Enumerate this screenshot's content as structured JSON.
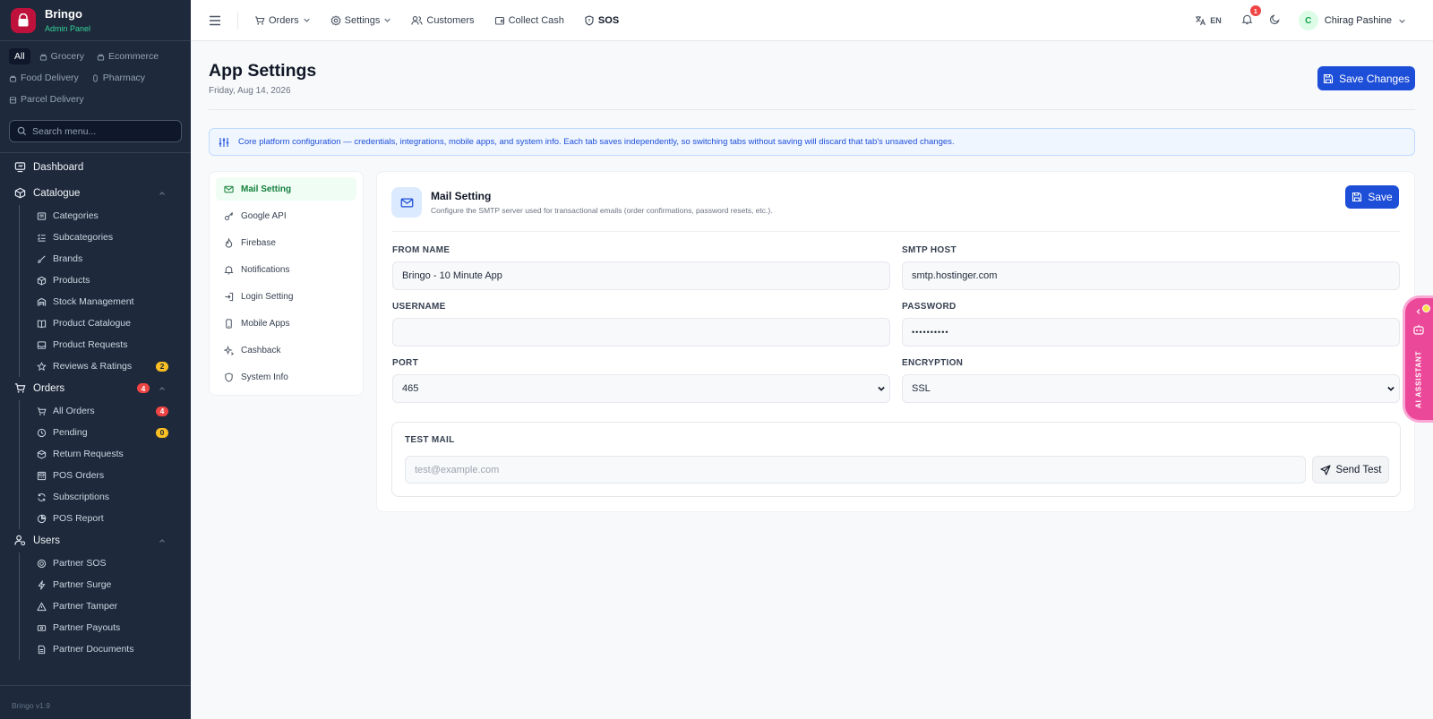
{
  "brand": {
    "name": "Bringo",
    "subtitle": "Admin Panel",
    "version": "Bringo v1.9"
  },
  "sidebar": {
    "filters": [
      "All",
      "Grocery",
      "Ecommerce",
      "Food Delivery",
      "Pharmacy",
      "Parcel Delivery"
    ],
    "search_placeholder": "Search menu...",
    "dashboard": "Dashboard",
    "catalogue": {
      "label": "Catalogue",
      "items": [
        {
          "label": "Categories",
          "icon": "folder-icon"
        },
        {
          "label": "Subcategories",
          "icon": "list-check-icon"
        },
        {
          "label": "Brands",
          "icon": "brush-icon"
        },
        {
          "label": "Products",
          "icon": "box-icon"
        },
        {
          "label": "Stock Management",
          "icon": "warehouse-icon"
        },
        {
          "label": "Product Catalogue",
          "icon": "book-icon"
        },
        {
          "label": "Product Requests",
          "icon": "inbox-icon"
        },
        {
          "label": "Reviews & Ratings",
          "icon": "star-icon",
          "badge": "2"
        }
      ]
    },
    "orders": {
      "label": "Orders",
      "badge": "4",
      "items": [
        {
          "label": "All Orders",
          "icon": "cart-icon",
          "badge": "4"
        },
        {
          "label": "Pending",
          "icon": "clock-icon",
          "badge": "0"
        },
        {
          "label": "Return Requests",
          "icon": "return-box-icon"
        },
        {
          "label": "POS Orders",
          "icon": "pos-icon"
        },
        {
          "label": "Subscriptions",
          "icon": "refresh-icon"
        },
        {
          "label": "POS Report",
          "icon": "pie-chart-icon"
        }
      ]
    },
    "users": {
      "label": "Users",
      "items": [
        {
          "label": "Partner SOS",
          "icon": "sos-icon"
        },
        {
          "label": "Partner Surge",
          "icon": "bolt-icon"
        },
        {
          "label": "Partner Tamper",
          "icon": "warning-icon"
        },
        {
          "label": "Partner Payouts",
          "icon": "payout-icon"
        },
        {
          "label": "Partner Documents",
          "icon": "document-icon"
        }
      ]
    }
  },
  "topbar": {
    "nav": [
      {
        "label": "Orders",
        "icon": "cart-icon",
        "dropdown": true
      },
      {
        "label": "Settings",
        "icon": "gear-icon",
        "dropdown": true
      },
      {
        "label": "Customers",
        "icon": "users-icon",
        "dropdown": false
      },
      {
        "label": "Collect Cash",
        "icon": "wallet-icon",
        "dropdown": false
      },
      {
        "label": "SOS",
        "icon": "shield-icon",
        "dropdown": false
      }
    ],
    "lang": "EN",
    "notifications": "1",
    "user": {
      "initial": "C",
      "name": "Chirag Pashine"
    }
  },
  "page": {
    "title": "App Settings",
    "date": "Friday, Aug 14, 2026",
    "save_changes": "Save Changes",
    "info": "Core platform configuration — credentials, integrations, mobile apps, and system info. Each tab saves independently, so switching tabs without saving will discard that tab's unsaved changes."
  },
  "tabs": [
    {
      "label": "Mail Setting",
      "icon": "mail-icon",
      "active": true
    },
    {
      "label": "Google API",
      "icon": "key-icon"
    },
    {
      "label": "Firebase",
      "icon": "flame-icon"
    },
    {
      "label": "Notifications",
      "icon": "bell-icon"
    },
    {
      "label": "Login Setting",
      "icon": "login-icon"
    },
    {
      "label": "Mobile Apps",
      "icon": "phone-icon"
    },
    {
      "label": "Cashback",
      "icon": "sparkle-icon"
    },
    {
      "label": "System Info",
      "icon": "shield-icon"
    }
  ],
  "form": {
    "title": "Mail Setting",
    "description": "Configure the SMTP server used for transactional emails (order confirmations, password resets, etc.).",
    "save": "Save",
    "from_name": {
      "label": "FROM NAME",
      "value": "Bringo - 10 Minute App"
    },
    "smtp_host": {
      "label": "SMTP HOST",
      "value": "smtp.hostinger.com"
    },
    "username": {
      "label": "USERNAME",
      "value": ""
    },
    "password": {
      "label": "PASSWORD",
      "value": "••••••••••"
    },
    "port": {
      "label": "PORT",
      "value": "465"
    },
    "encryption": {
      "label": "ENCRYPTION",
      "value": "SSL"
    },
    "test_mail": {
      "label": "TEST MAIL",
      "placeholder": "test@example.com",
      "button": "Send Test"
    }
  },
  "assistant": {
    "label": "AI ASSISTANT"
  },
  "colors": {
    "sidebar": "#1e293b",
    "primary": "#1d4ed8",
    "active_tab": "#15803d",
    "assistant": "#ec4899"
  }
}
